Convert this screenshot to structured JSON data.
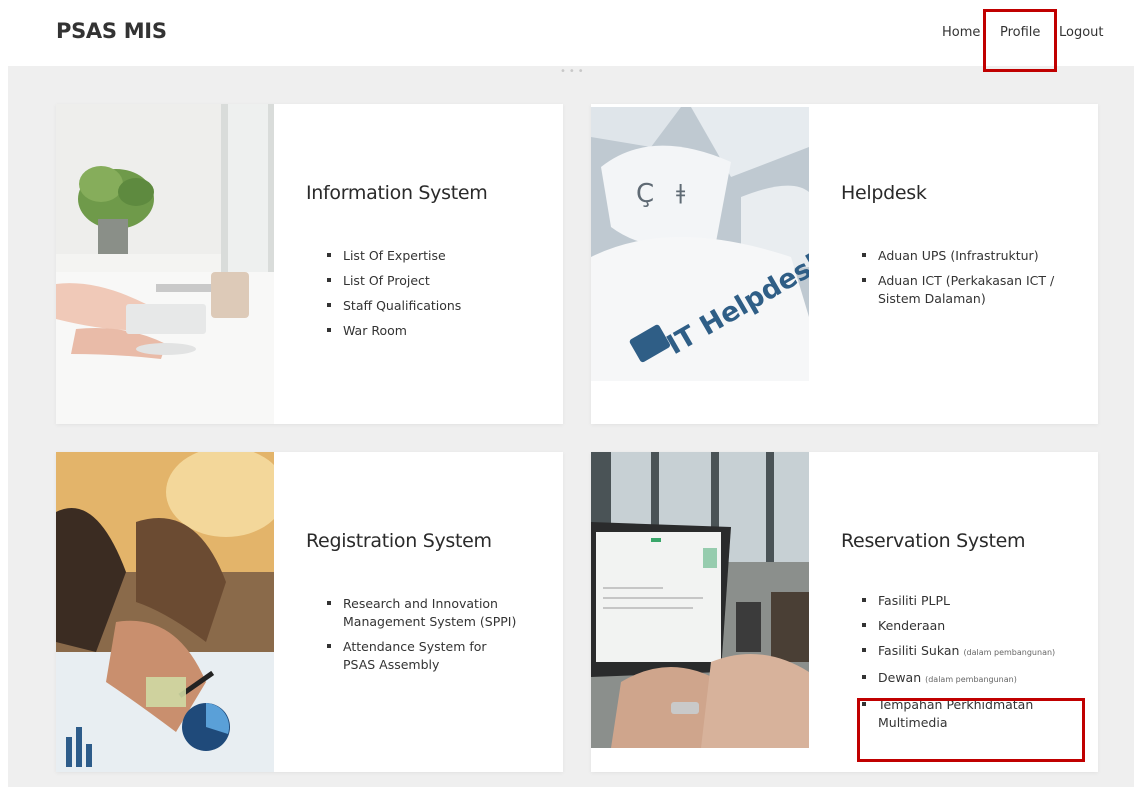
{
  "header": {
    "brand": "PSAS MIS",
    "nav": {
      "home": "Home",
      "profile": "Profile",
      "logout": "Logout"
    }
  },
  "cards": [
    {
      "title": "Information System",
      "image": "office-laptop-photo",
      "items": [
        "List Of Expertise",
        "List Of Project",
        "Staff Qualifications",
        "War Room"
      ]
    },
    {
      "title": "Helpdesk",
      "image": "it-helpdesk-keyboard-photo",
      "image_text": "IT Helpdesk",
      "items": [
        "Aduan UPS (Infrastruktur)",
        "Aduan ICT (Perkakasan ICT / Sistem Dalaman)"
      ]
    },
    {
      "title": "Registration System",
      "image": "business-charts-photo",
      "items": [
        "Research and Innovation Management System (SPPI)",
        "Attendance System for PSAS Assembly"
      ]
    },
    {
      "title": "Reservation System",
      "image": "laptop-typing-photo",
      "items": [
        {
          "label": "Fasiliti PLPL",
          "note": ""
        },
        {
          "label": "Kenderaan",
          "note": ""
        },
        {
          "label": "Fasiliti Sukan",
          "note": "(dalam pembangunan)"
        },
        {
          "label": "Dewan",
          "note": "(dalam pembangunan)"
        },
        {
          "label": "Tempahan Perkhidmatan Multimedia",
          "note": ""
        }
      ]
    }
  ],
  "colors": {
    "highlight": "#c00000",
    "background": "#efefef",
    "card": "#ffffff"
  }
}
